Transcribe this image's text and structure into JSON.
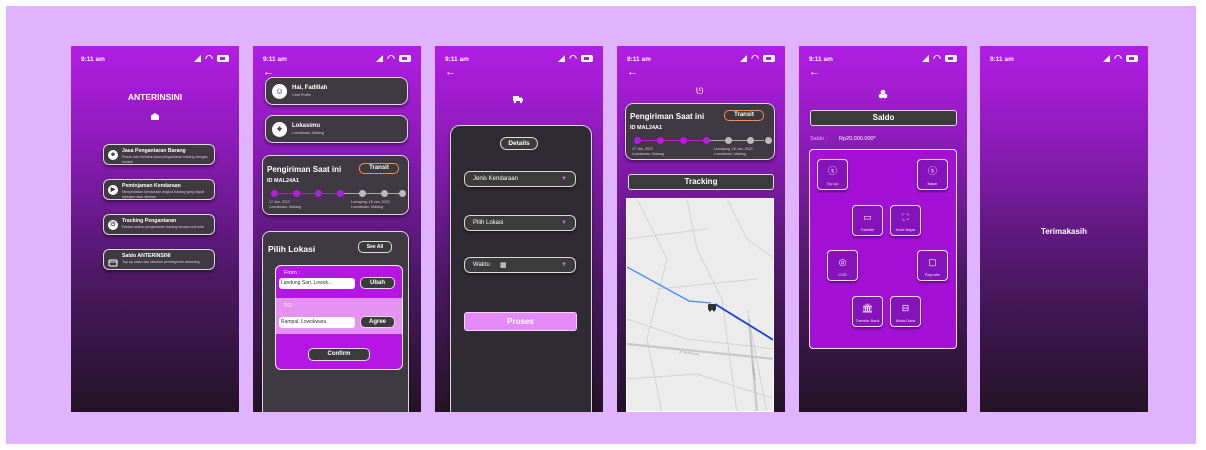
{
  "status_time": "9:11 am",
  "screen1": {
    "app_title": "ANTERINSINI",
    "menu": [
      {
        "title": "Jasa Pengantaran Barang",
        "desc": "Pesan dan kirimkan jasa pengantaran barang dengan mudah"
      },
      {
        "title": "Peminjaman Kendaraan",
        "desc": "Menyediakan kendaraan angkut barang yang dapat dipinjam atau disewa"
      },
      {
        "title": "Tracking Pengantaran",
        "desc": "Pantau status pengantaran barang secara real-time"
      },
      {
        "title": "Saldo ANTERINSINI",
        "desc": "Top up saldo dan lakukan pembayaran sekarang"
      }
    ]
  },
  "screen2": {
    "greeting": "Hai, Fadillah",
    "profile_sub": "Lihat Profile",
    "location_title": "Lokasimu",
    "location_sub": "Lowokwaru, Malang",
    "shipment_title": "Pengiriman Saat ini",
    "shipment_status": "Transit",
    "shipment_id": "ID MAL24A1",
    "origin_date": "17 Jan, 2023",
    "origin_place": "Lowokwaru, Malang",
    "dest_date": "Lumajang, 18 Jan, 2023",
    "dest_place": "Lowokwaru, Malang",
    "pick_title": "Pilih Lokasi",
    "see_all": "See All",
    "from_label": "From :",
    "from_value": "Landung Sari, Lowok...",
    "from_btn": "Ubah",
    "to_label": "TO :",
    "to_value": "Rampal, Lowokwaru",
    "to_btn": "Agree",
    "confirm": "Confirm"
  },
  "screen3": {
    "details": "Details",
    "options": [
      "Jenis Kendaraan",
      "Pilih Lokasi",
      "Waktu"
    ],
    "proses": "Proses"
  },
  "screen4": {
    "shipment_title": "Pengiriman Saat ini",
    "shipment_status": "Transit",
    "shipment_id": "ID MAL24A1",
    "origin_date": "17 Jan, 2023",
    "origin_place": "Lowokwaru, Malang",
    "dest_date": "Lumajang, 18 Jan, 2023",
    "dest_place": "Lowokwaru, Malang",
    "tracking": "Tracking",
    "street_label_1": "Jl. Sumbersari",
    "street_label_2": "Jl. Gajayana"
  },
  "screen5": {
    "title": "Saldo",
    "saldo_label": "Saldo :",
    "saldo_value": "Rp20.000.000*",
    "tiles": [
      "Top Up",
      "Bayar",
      "Transfer",
      "Kode Bayar",
      "COD",
      "PayLater",
      "Transfer Bank",
      "Minta Dana"
    ]
  },
  "screen6": {
    "thanks": "Terimakasih"
  }
}
